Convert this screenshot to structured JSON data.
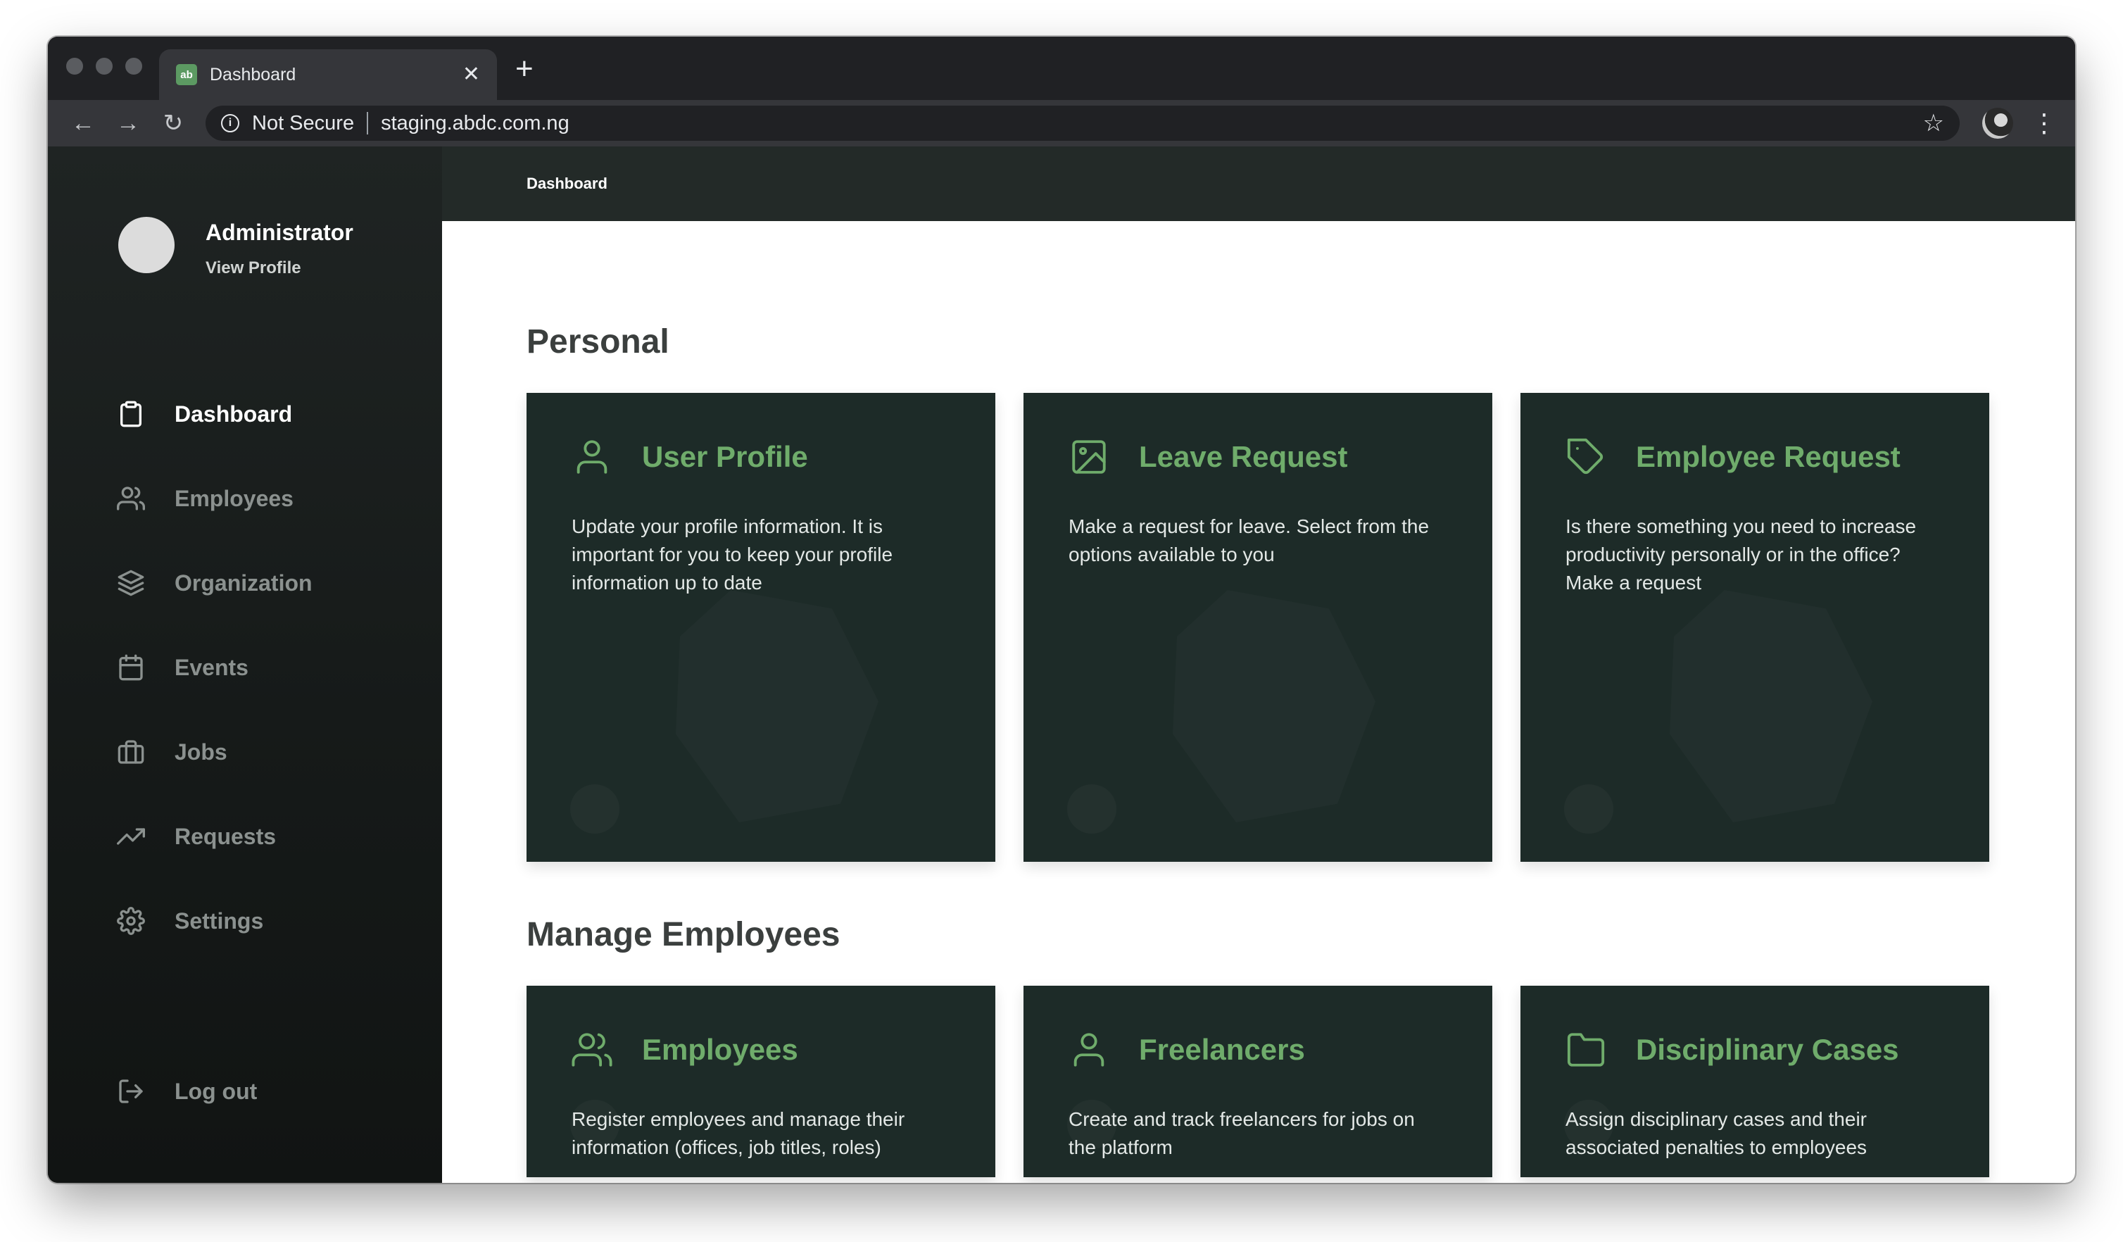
{
  "browser": {
    "tab_title": "Dashboard",
    "tab_favicon_text": "ab",
    "security_label": "Not Secure",
    "url": "staging.abdc.com.ng"
  },
  "sidebar": {
    "profile_name": "Administrator",
    "profile_link": "View Profile",
    "items": [
      {
        "label": "Dashboard",
        "icon": "clipboard-icon",
        "active": true
      },
      {
        "label": "Employees",
        "icon": "users-icon",
        "active": false
      },
      {
        "label": "Organization",
        "icon": "layers-icon",
        "active": false
      },
      {
        "label": "Events",
        "icon": "calendar-icon",
        "active": false
      },
      {
        "label": "Jobs",
        "icon": "briefcase-icon",
        "active": false
      },
      {
        "label": "Requests",
        "icon": "trending-up-icon",
        "active": false
      },
      {
        "label": "Settings",
        "icon": "gear-icon",
        "active": false
      }
    ],
    "logout_label": "Log out"
  },
  "header": {
    "breadcrumb": "Dashboard"
  },
  "sections": {
    "personal": {
      "title": "Personal",
      "cards": [
        {
          "title": "User Profile",
          "icon": "user-icon",
          "description": "Update your profile information. It is important for you to keep your profile information up to date"
        },
        {
          "title": "Leave Request",
          "icon": "image-icon",
          "description": "Make a request for leave. Select from the options available to you"
        },
        {
          "title": "Employee Request",
          "icon": "tag-icon",
          "description": "Is there something you need to increase productivity personally or in the office? Make a request"
        }
      ]
    },
    "manage": {
      "title": "Manage Employees",
      "cards": [
        {
          "title": "Employees",
          "icon": "users-icon",
          "description": "Register employees and manage their information (offices, job titles, roles)"
        },
        {
          "title": "Freelancers",
          "icon": "user-icon",
          "description": "Create and track freelancers for jobs on the platform"
        },
        {
          "title": "Disciplinary Cases",
          "icon": "folder-icon",
          "description": "Assign disciplinary cases and their associated penalties to employees"
        }
      ]
    }
  },
  "colors": {
    "accent": "#6fac6b",
    "card_bg": "#1d2b28",
    "sidebar_bg": "#161a19"
  }
}
